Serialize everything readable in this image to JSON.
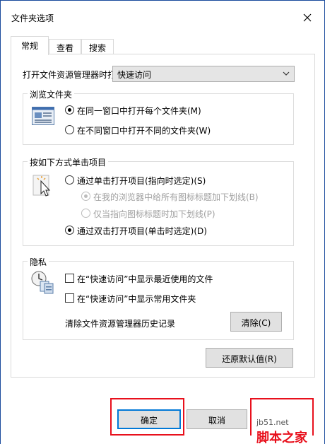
{
  "window": {
    "title": "文件夹选项"
  },
  "tabs": [
    {
      "label": "常规",
      "active": true
    },
    {
      "label": "查看",
      "active": false
    },
    {
      "label": "搜索",
      "active": false
    }
  ],
  "open_explorer": {
    "label": "打开文件资源管理器时打",
    "value": "快速访问"
  },
  "browse_folders": {
    "title": "浏览文件夹",
    "icon": "window-icon",
    "options": [
      {
        "label": "在同一窗口中打开每个文件夹(M)",
        "checked": true
      },
      {
        "label": "在不同窗口中打开不同的文件夹(W)",
        "checked": false
      }
    ]
  },
  "click_items": {
    "title": "按如下方式单击项目",
    "icon": "cursor-click-icon",
    "options": [
      {
        "label": "通过单击打开项目(指向时选定)(S)",
        "checked": false,
        "disabled": false
      },
      {
        "label": "在我的浏览器中给所有图标标题加下划线(B)",
        "checked": true,
        "disabled": true
      },
      {
        "label": "仅当指向图标标题时加下划线(P)",
        "checked": false,
        "disabled": true
      },
      {
        "label": "通过双击打开项目(单击时选定)(D)",
        "checked": true,
        "disabled": false
      }
    ]
  },
  "privacy": {
    "title": "隐私",
    "icon": "clock-documents-icon",
    "checks": [
      {
        "label": "在“快速访问”中显示最近使用的文件",
        "checked": false
      },
      {
        "label": "在“快速访问”中显示常用文件夹",
        "checked": false
      }
    ],
    "clear_label": "清除文件资源管理器历史记录",
    "clear_button": "清除(C)"
  },
  "restore_button": "还原默认值(R)",
  "footer": {
    "ok": "确定",
    "cancel": "取消"
  },
  "watermark": {
    "site": "jb51.net",
    "name": "脚本之家"
  },
  "colors": {
    "highlight": "#e8101c",
    "accent": "#1a4a9c"
  }
}
